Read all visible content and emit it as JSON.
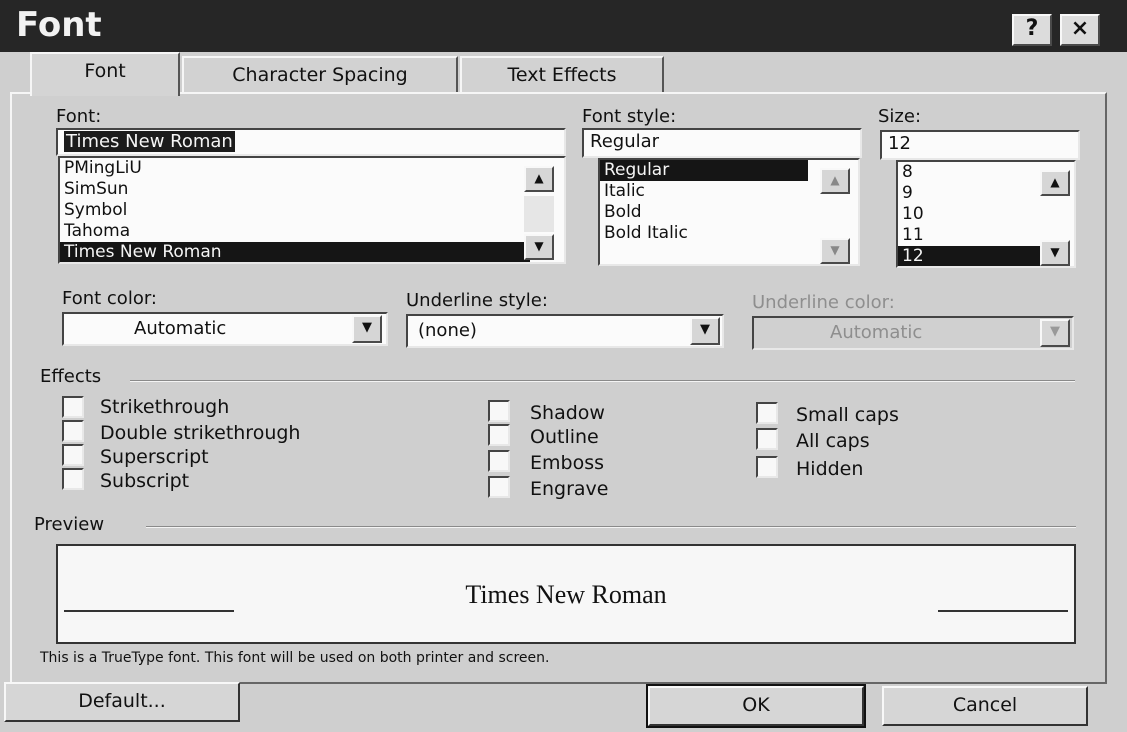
{
  "window": {
    "title": "Font",
    "help_icon": "?",
    "close_icon": "×"
  },
  "tabs": [
    {
      "label": "Font"
    },
    {
      "label": "Character Spacing"
    },
    {
      "label": "Text Effects"
    }
  ],
  "font": {
    "label": "Font:",
    "value": "Times New Roman",
    "items": [
      "PMingLiU",
      "SimSun",
      "Symbol",
      "Tahoma",
      "Times New Roman"
    ],
    "selected": "Times New Roman"
  },
  "style": {
    "label": "Font style:",
    "value": "Regular",
    "items": [
      "Regular",
      "Italic",
      "Bold",
      "Bold Italic"
    ],
    "selected": "Regular"
  },
  "size": {
    "label": "Size:",
    "value": "12",
    "items": [
      "8",
      "9",
      "10",
      "11",
      "12"
    ],
    "selected": "12"
  },
  "font_color": {
    "label": "Font color:",
    "value": "Automatic"
  },
  "underline_style": {
    "label": "Underline style:",
    "value": "(none)"
  },
  "underline_color": {
    "label": "Underline color:",
    "value": "Automatic",
    "disabled": true
  },
  "effects": {
    "label": "Effects",
    "col1": [
      "Strikethrough",
      "Double strikethrough",
      "Superscript",
      "Subscript"
    ],
    "col2": [
      "Shadow",
      "Outline",
      "Emboss",
      "Engrave"
    ],
    "col3": [
      "Small caps",
      "All caps",
      "Hidden"
    ]
  },
  "preview": {
    "label": "Preview",
    "text": "Times New Roman",
    "note": "This is a TrueType font. This font will be used on both printer and screen."
  },
  "buttons": {
    "default": "Default...",
    "ok": "OK",
    "cancel": "Cancel"
  }
}
